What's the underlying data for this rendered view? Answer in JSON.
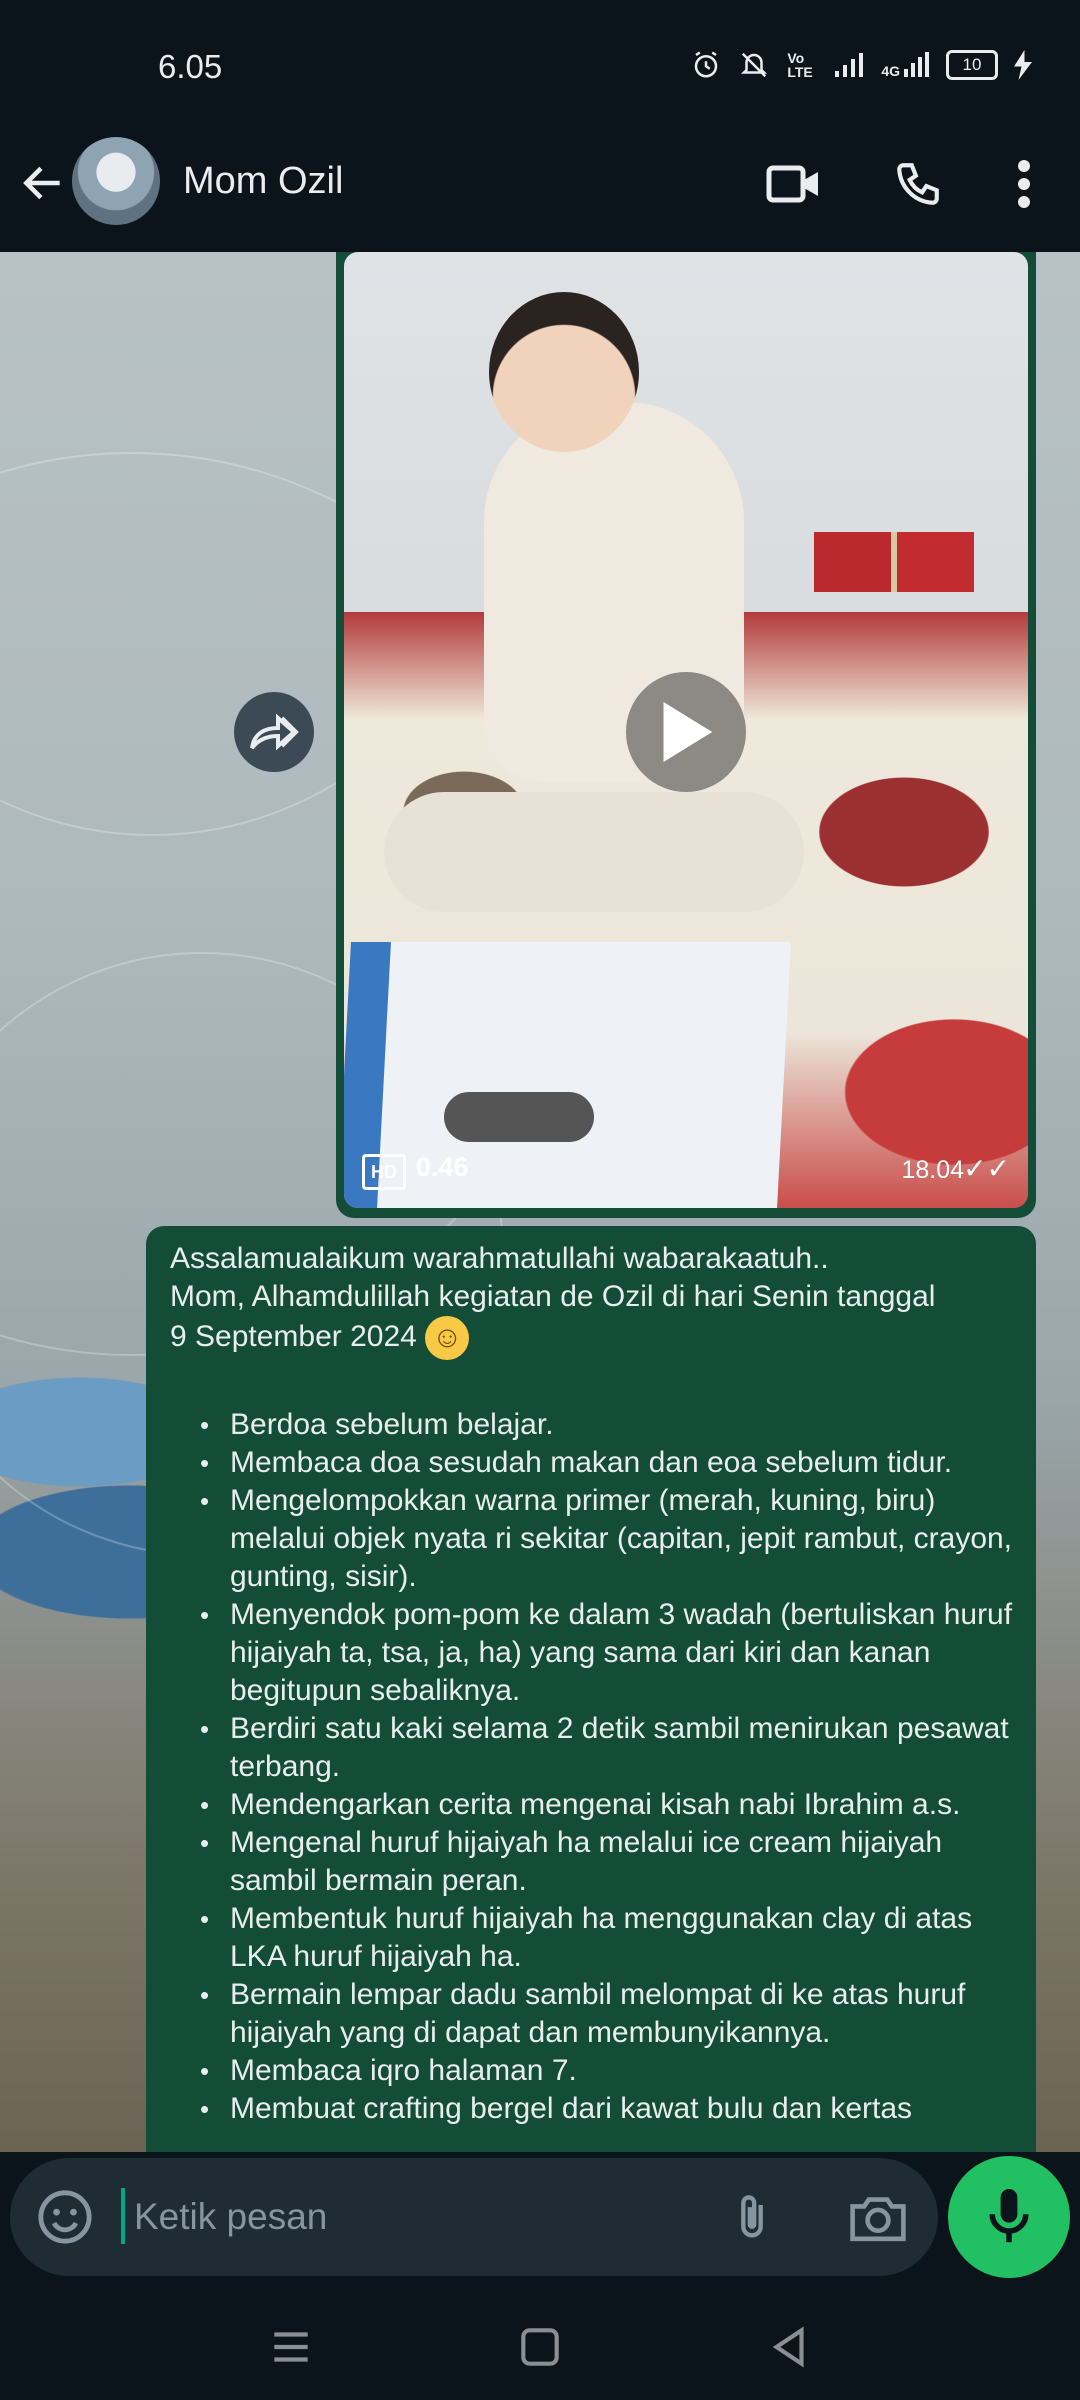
{
  "status_bar": {
    "time": "6.05",
    "battery_level": "10",
    "network": "4G",
    "volte": "Vo LTE",
    "icons": [
      "alarm-icon",
      "mute-icon",
      "volte-icon",
      "signal-icon",
      "signal-4g-icon",
      "battery-icon",
      "charging-icon"
    ]
  },
  "header": {
    "contact_name": "Mom Ozil",
    "icons": [
      "back-arrow-icon",
      "avatar",
      "video-call-icon",
      "voice-call-icon",
      "more-options-icon"
    ]
  },
  "media_message": {
    "quality_badge": "HD",
    "duration": "0.46",
    "time": "18.04",
    "ticks": "✓✓"
  },
  "text_message": {
    "intro_lines": [
      "Assalamualaikum warahmatullahi wabarakaatuh..",
      "Mom, Alhamdulillah kegiatan de Ozil di hari Senin tanggal",
      "9 September 2024"
    ],
    "emoji": "☺",
    "items": [
      "Berdoa sebelum belajar.",
      "Membaca doa sesudah makan dan eoa sebelum tidur.",
      "Mengelompokkan warna primer (merah, kuning, biru) melalui objek nyata ri sekitar (capitan, jepit rambut, crayon, gunting, sisir).",
      "Menyendok pom-pom ke dalam 3 wadah (bertuliskan huruf hijaiyah ta, tsa, ja, ha) yang sama dari kiri dan kanan begitupun sebaliknya.",
      "Berdiri satu kaki selama 2 detik sambil menirukan pesawat terbang.",
      "Mendengarkan cerita mengenai kisah nabi Ibrahim a.s.",
      "Mengenal huruf hijaiyah ha melalui ice cream hijaiyah sambil bermain peran.",
      "Membentuk huruf hijaiyah ha menggunakan clay di atas LKA huruf hijaiyah ha.",
      "Bermain lempar dadu sambil melompat di ke atas huruf hijaiyah yang di dapat dan membunyikannya.",
      "Membaca iqro halaman 7.",
      "Membuat crafting bergel dari kawat bulu dan kertas"
    ]
  },
  "composer": {
    "placeholder": "Ketik pesan",
    "icons": [
      "emoji-icon",
      "attach-icon",
      "camera-icon",
      "mic-icon"
    ]
  },
  "colors": {
    "bubble_outgoing": "#134d37",
    "accent_green": "#21c063",
    "bar_background": "#0b141a",
    "composer_background": "#1f2c34"
  }
}
